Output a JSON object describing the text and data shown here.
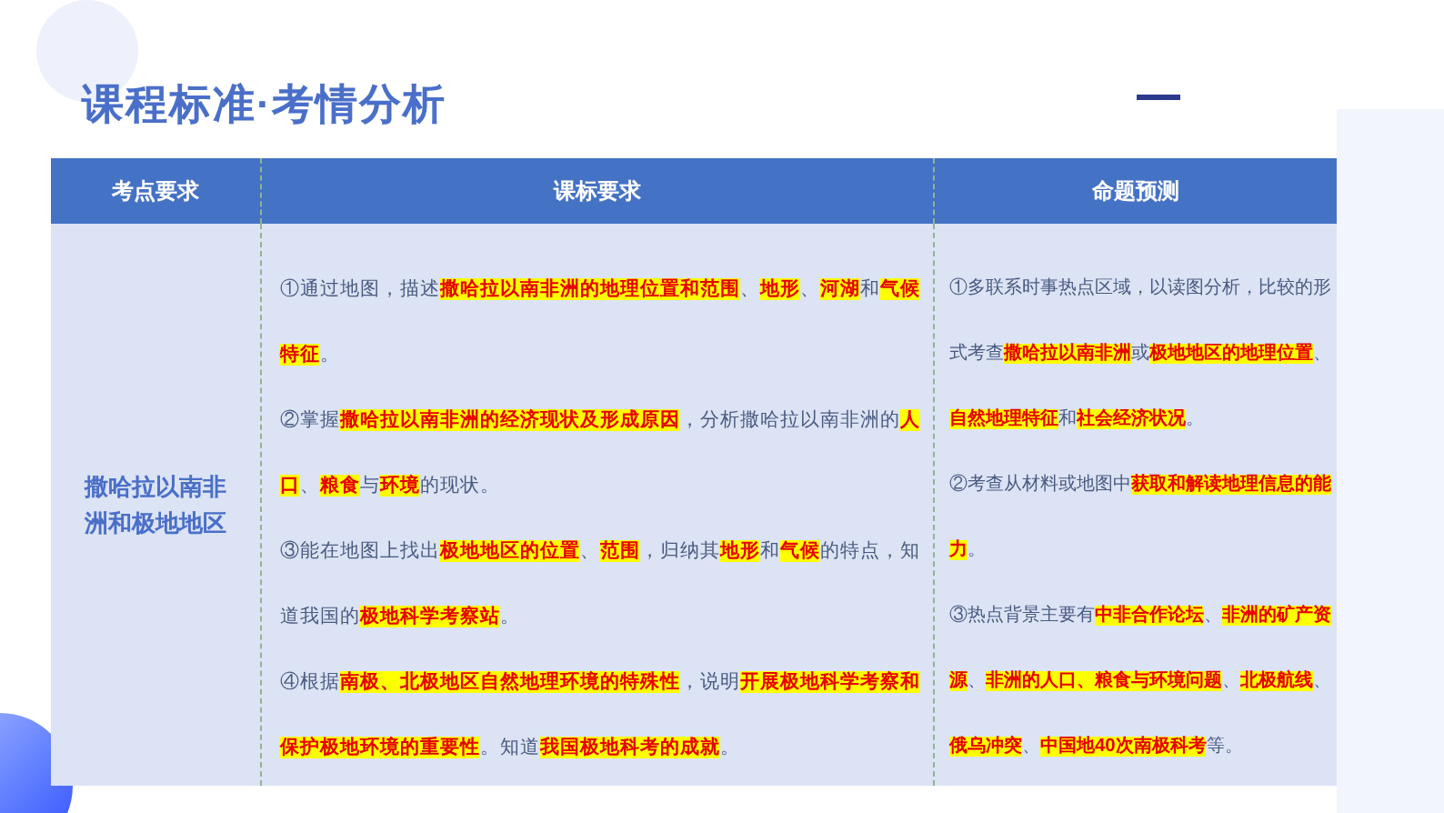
{
  "title": "课程标准·考情分析",
  "table": {
    "columns": [
      "考点要求",
      "课标要求",
      "命题预测"
    ],
    "rows": [
      {
        "topic": "撒哈拉以南非洲和极地地区",
        "requirements": [
          "①通过地图，描述**撒哈拉以南非洲的地理位置和范围**、**地形**、**河湖**和**气候特征**。",
          "②掌握**撒哈拉以南非洲的经济现状及形成原因**，分析撒哈拉以南非洲的**人口**、**粮食**与**环境**的现状。",
          "③能在地图上找出**极地地区的位置**、**范围**，归纳其**地形**和**气候**的特点，知道我国的**极地科学考察站**。",
          "④根据**南极、北极地区自然地理环境的特殊性**，说明**开展极地科学考察和保护极地环境的重要性**。知道**我国极地科考的成就**。"
        ],
        "predictions": [
          "①多联系时事热点区域，以读图分析，比较的形式考查**撒哈拉以南非洲**或**极地地区的地理位置**、**自然地理特征**和**社会经济状况**。",
          "②考查从材料或地图中**获取和解读地理信息的能力**。",
          "③热点背景主要有**中非合作论坛**、**非洲的矿产资源**、**非洲的人口、粮食与环境问题**、**北极航线**、**俄乌冲突**、**中国地40次南极科考**等。"
        ]
      }
    ]
  }
}
